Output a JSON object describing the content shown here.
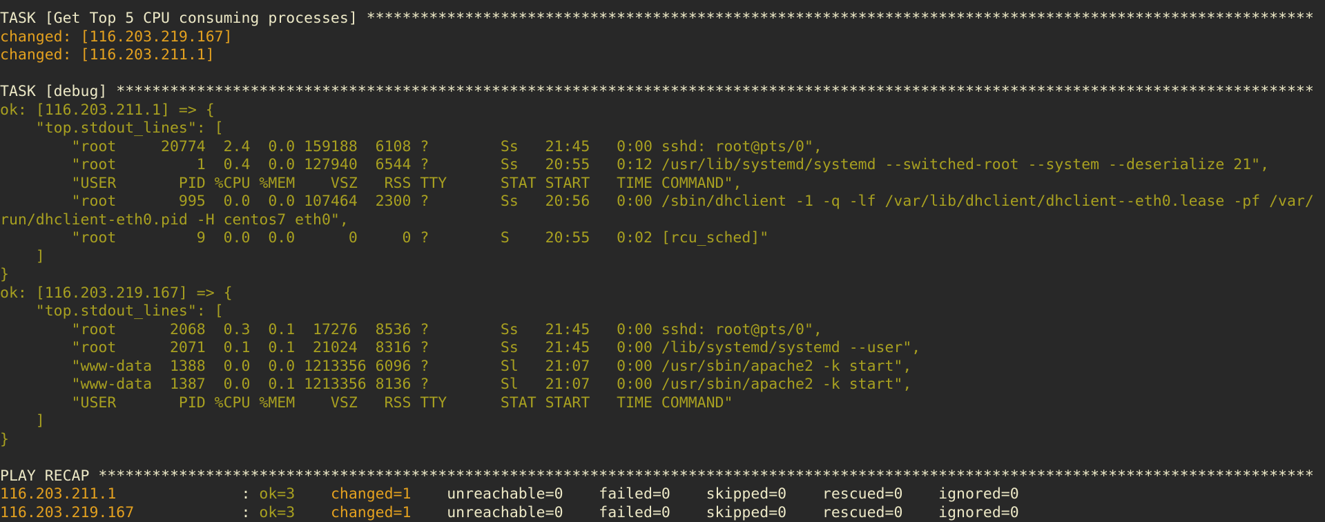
{
  "colors": {
    "background": "#282828",
    "default": "#ece8c6",
    "changed": "#e4a11f",
    "ok": "#a8a020"
  },
  "task1": {
    "header": "TASK [Get Top 5 CPU consuming processes] ",
    "stars": "**********************************************************************************************************",
    "results": [
      "changed: [116.203.219.167]",
      "changed: [116.203.211.1]"
    ]
  },
  "task2": {
    "header": "TASK [debug] ",
    "stars": "**************************************************************************************************************************************",
    "hosts": [
      {
        "open": "ok: [116.203.211.1] => {",
        "key": "    \"top.stdout_lines\": [",
        "lines": [
          "        \"root     20774  2.4  0.0 159188  6108 ?        Ss   21:45   0:00 sshd: root@pts/0\",",
          "        \"root         1  0.4  0.0 127940  6544 ?        Ss   20:55   0:12 /usr/lib/systemd/systemd --switched-root --system --deserialize 21\",",
          "        \"USER       PID %CPU %MEM    VSZ   RSS TTY      STAT START   TIME COMMAND\",",
          "        \"root       995  0.0  0.0 107464  2300 ?        Ss   20:56   0:00 /sbin/dhclient -1 -q -lf /var/lib/dhclient/dhclient--eth0.lease -pf /var/run/dhclient-eth0.pid -H centos7 eth0\",",
          "        \"root         9  0.0  0.0      0     0 ?        S    20:55   0:02 [rcu_sched]\""
        ],
        "close_list": "    ]",
        "close": "}"
      },
      {
        "open": "ok: [116.203.219.167] => {",
        "key": "    \"top.stdout_lines\": [",
        "lines": [
          "        \"root      2068  0.3  0.1  17276  8536 ?        Ss   21:45   0:00 sshd: root@pts/0\",",
          "        \"root      2071  0.1  0.1  21024  8316 ?        Ss   21:45   0:00 /lib/systemd/systemd --user\",",
          "        \"www-data  1388  0.0  0.0 1213356 6096 ?        Sl   21:07   0:00 /usr/sbin/apache2 -k start\",",
          "        \"www-data  1387  0.0  0.1 1213356 8136 ?        Sl   21:07   0:00 /usr/sbin/apache2 -k start\",",
          "        \"USER       PID %CPU %MEM    VSZ   RSS TTY      STAT START   TIME COMMAND\""
        ],
        "close_list": "    ]",
        "close": "}"
      }
    ]
  },
  "recap": {
    "header": "PLAY RECAP ",
    "stars": "****************************************************************************************************************************************",
    "rows": [
      {
        "host": "116.203.211.1             ",
        "sep": " : ",
        "ok": "ok=3    ",
        "changed": "changed=1    ",
        "rest": "unreachable=0    failed=0    skipped=0    rescued=0    ignored=0"
      },
      {
        "host": "116.203.219.167           ",
        "sep": " : ",
        "ok": "ok=3    ",
        "changed": "changed=1    ",
        "rest": "unreachable=0    failed=0    skipped=0    rescued=0    ignored=0"
      }
    ]
  }
}
